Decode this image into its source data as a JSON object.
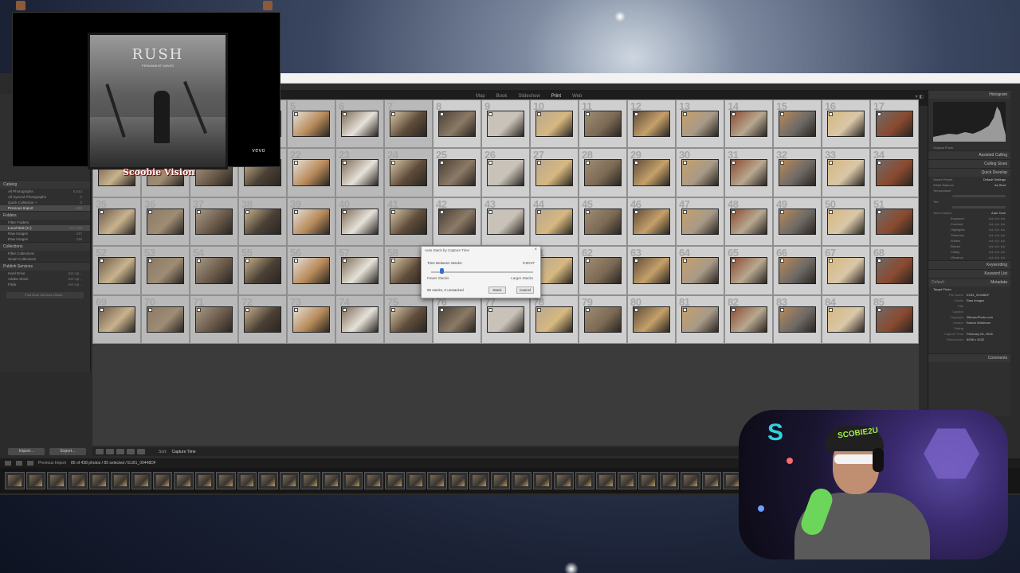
{
  "module_tabs": [
    "Map",
    "Book",
    "Slideshow",
    "Print",
    "Web"
  ],
  "left_panel": {
    "catalog_label": "Catalog",
    "catalog_items": [
      {
        "label": "All Photographs",
        "count": "6,543"
      },
      {
        "label": "All Synced Photographs",
        "count": "0"
      },
      {
        "label": "Quick Collection +",
        "count": "0"
      },
      {
        "label": "Previous Import",
        "count": "438"
      }
    ],
    "folders_label": "Folders",
    "folder_items": [
      {
        "label": "Filter Folders",
        "count": ""
      },
      {
        "label": "Local Disk (C:)",
        "count": "54 / 119"
      },
      {
        "label": "Raw Images",
        "count": "437"
      },
      {
        "label": "Raw Images",
        "count": "438"
      }
    ],
    "collections_label": "Collections",
    "collection_items": [
      {
        "label": "Filter Collections",
        "count": ""
      },
      {
        "label": "Smart Collections",
        "count": ""
      }
    ],
    "publish_label": "Publish Services",
    "publish_items": [
      {
        "label": "Hard Drive",
        "count": "Set Up..."
      },
      {
        "label": "Adobe Stock",
        "count": "Set Up..."
      },
      {
        "label": "Flickr",
        "count": "Set Up..."
      }
    ],
    "find_more_label": "Find More Services Online...",
    "import_label": "Import...",
    "export_label": "Export..."
  },
  "grid": {
    "start_number": 1,
    "selected_cells": [
      8,
      9,
      10,
      11,
      12,
      13,
      14,
      15,
      16,
      17,
      25,
      26,
      27,
      28,
      29,
      30,
      31,
      32,
      33,
      34,
      42,
      43,
      44,
      45,
      46,
      47,
      48,
      49,
      50,
      51,
      59,
      60,
      61,
      62,
      63,
      64,
      65,
      66,
      67,
      68,
      76,
      77,
      78,
      79,
      80,
      81,
      82,
      83,
      84,
      85
    ],
    "thumb_colors": [
      "#6b5a4a",
      "#8b7a66",
      "#a89a88",
      "#c9b38e",
      "#e6e2da",
      "#7c6a55",
      "#d9c7a8",
      "#4a4035",
      "#c8c2b8",
      "#b8a890",
      "#9e8c74",
      "#5e4c3a",
      "#c5a06a",
      "#8a4a30",
      "#b88a5a",
      "#d6b880",
      "#6e6a66"
    ]
  },
  "toolbar": {
    "sort_label": "Sort:",
    "sort_value": "Capture Time"
  },
  "filmstrip": {
    "source": "Previous Import",
    "status": "85 of 438 photos / 85 selected / ELB1_00448DF"
  },
  "dialog": {
    "title": "Auto Stack by Capture Time",
    "close": "×",
    "label": "Time Between Stacks:",
    "time": "0:00:07",
    "slider_fraction": 0.1,
    "min_label": "Fewer Stacks",
    "max_label": "Larger Stacks",
    "info": "85 stacks, 0 unstacked",
    "stack_button": "Stack",
    "cancel_button": "Cancel"
  },
  "right_panel": {
    "histogram_label": "Histogram",
    "smart_preview": "Original Photo",
    "assisted_culling": "Assisted Culling",
    "culling_sizes": "Culling Sizes",
    "quick_develop": "Quick Develop",
    "saved_preset_label": "Saved Preset",
    "saved_preset_value": "Default Settings",
    "white_balance_label": "White Balance",
    "white_balance_value": "As Shot",
    "temperature_label": "Temperature",
    "tint_label": "Tint",
    "tone_control_label": "Tone Control",
    "tone_control_value": "Auto Tone",
    "tone_rows": [
      "Exposure",
      "Contrast",
      "Highlights",
      "Shadows",
      "Whites",
      "Blacks",
      "Clarity",
      "Vibrance"
    ],
    "keywording": "Keywording",
    "keyword_list": "Keyword List",
    "metadata": "Metadata",
    "metadata_preset": "Default",
    "target_photo": "Target Photo",
    "meta_fields": [
      {
        "k": "File Name",
        "v": "ELB1_00448DF"
      },
      {
        "k": "Folder",
        "v": "Raw Images"
      },
      {
        "k": "Title",
        "v": ""
      },
      {
        "k": "Caption",
        "v": ""
      },
      {
        "k": "Copyright",
        "v": "ZillowerPhoto.com"
      },
      {
        "k": "Creator",
        "v": "Robert Whitmore"
      },
      {
        "k": "Rating",
        "v": ""
      },
      {
        "k": "Capture Time",
        "v": "February 04, 2026"
      },
      {
        "k": "Dimensions",
        "v": "6048 x 4032"
      }
    ],
    "comments": "Comments"
  },
  "video_overlay": {
    "album_title": "RUSH",
    "album_sub": "PERMANENT WAVES",
    "vevo": "vevo",
    "caption": "Scoobie Vision"
  },
  "webcam": {
    "cap_text": "SCOBIE2U"
  }
}
